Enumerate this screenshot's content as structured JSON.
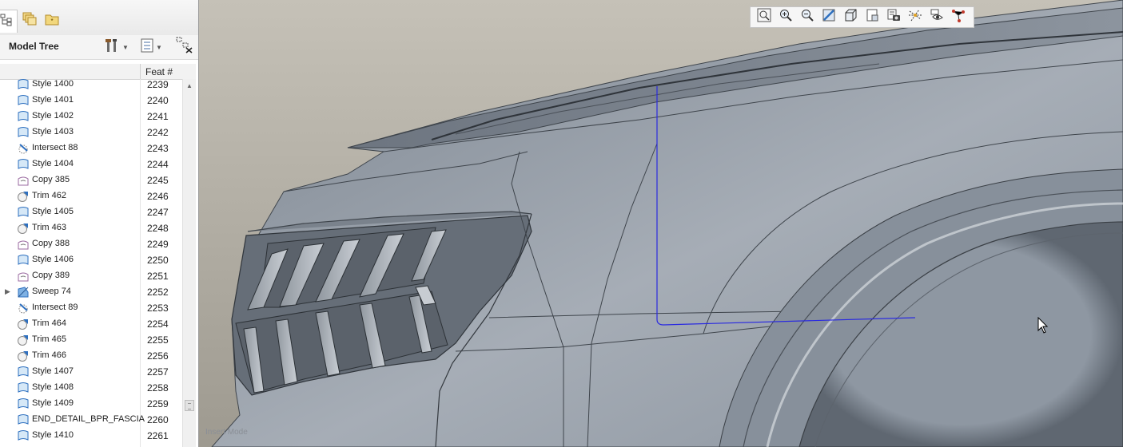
{
  "tabs": [
    {
      "icon": "model-tree-icon"
    },
    {
      "icon": "layers-icon"
    },
    {
      "icon": "favorites-icon"
    }
  ],
  "tree_header": {
    "title": "Model Tree",
    "settings_icon": "settings-tools-icon",
    "show_icon": "tree-columns-icon",
    "filter_icon": "tree-filter-icon"
  },
  "columns": {
    "feat_num": "Feat #"
  },
  "features": [
    {
      "name": "Style 1400",
      "num": "2239",
      "icon": "style"
    },
    {
      "name": "Style 1401",
      "num": "2240",
      "icon": "style"
    },
    {
      "name": "Style 1402",
      "num": "2241",
      "icon": "style"
    },
    {
      "name": "Style 1403",
      "num": "2242",
      "icon": "style"
    },
    {
      "name": "Intersect 88",
      "num": "2243",
      "icon": "intersect"
    },
    {
      "name": "Style 1404",
      "num": "2244",
      "icon": "style"
    },
    {
      "name": "Copy 385",
      "num": "2245",
      "icon": "copy"
    },
    {
      "name": "Trim 462",
      "num": "2246",
      "icon": "trim"
    },
    {
      "name": "Style 1405",
      "num": "2247",
      "icon": "style"
    },
    {
      "name": "Trim 463",
      "num": "2248",
      "icon": "trim"
    },
    {
      "name": "Copy 388",
      "num": "2249",
      "icon": "copy"
    },
    {
      "name": "Style 1406",
      "num": "2250",
      "icon": "style"
    },
    {
      "name": "Copy 389",
      "num": "2251",
      "icon": "copy"
    },
    {
      "name": "Sweep 74",
      "num": "2252",
      "icon": "sweep",
      "expandable": true
    },
    {
      "name": "Intersect 89",
      "num": "2253",
      "icon": "intersect"
    },
    {
      "name": "Trim 464",
      "num": "2254",
      "icon": "trim"
    },
    {
      "name": "Trim 465",
      "num": "2255",
      "icon": "trim"
    },
    {
      "name": "Trim 466",
      "num": "2256",
      "icon": "trim"
    },
    {
      "name": "Style 1407",
      "num": "2257",
      "icon": "style"
    },
    {
      "name": "Style 1408",
      "num": "2258",
      "icon": "style"
    },
    {
      "name": "Style 1409",
      "num": "2259",
      "icon": "style"
    },
    {
      "name": "END_DETAIL_BPR_FASCIA",
      "num": "2260",
      "icon": "style"
    },
    {
      "name": "Style 1410",
      "num": "2261",
      "icon": "style"
    }
  ],
  "view_toolbar": [
    {
      "name": "zoom-to-fit-icon"
    },
    {
      "name": "zoom-in-icon"
    },
    {
      "name": "zoom-out-icon"
    },
    {
      "name": "repaint-icon"
    },
    {
      "name": "display-style-icon"
    },
    {
      "name": "saved-orientations-icon"
    },
    {
      "name": "view-manager-icon"
    },
    {
      "name": "datum-display-icon"
    },
    {
      "name": "annotation-display-icon"
    },
    {
      "name": "spin-center-icon"
    }
  ],
  "viewport": {
    "watermark": "Insert Mode"
  },
  "colors": {
    "accent": "#2d6fbf",
    "model": "#8d97a3",
    "background": "#aaa59a",
    "sketch": "#2a2ae0"
  }
}
